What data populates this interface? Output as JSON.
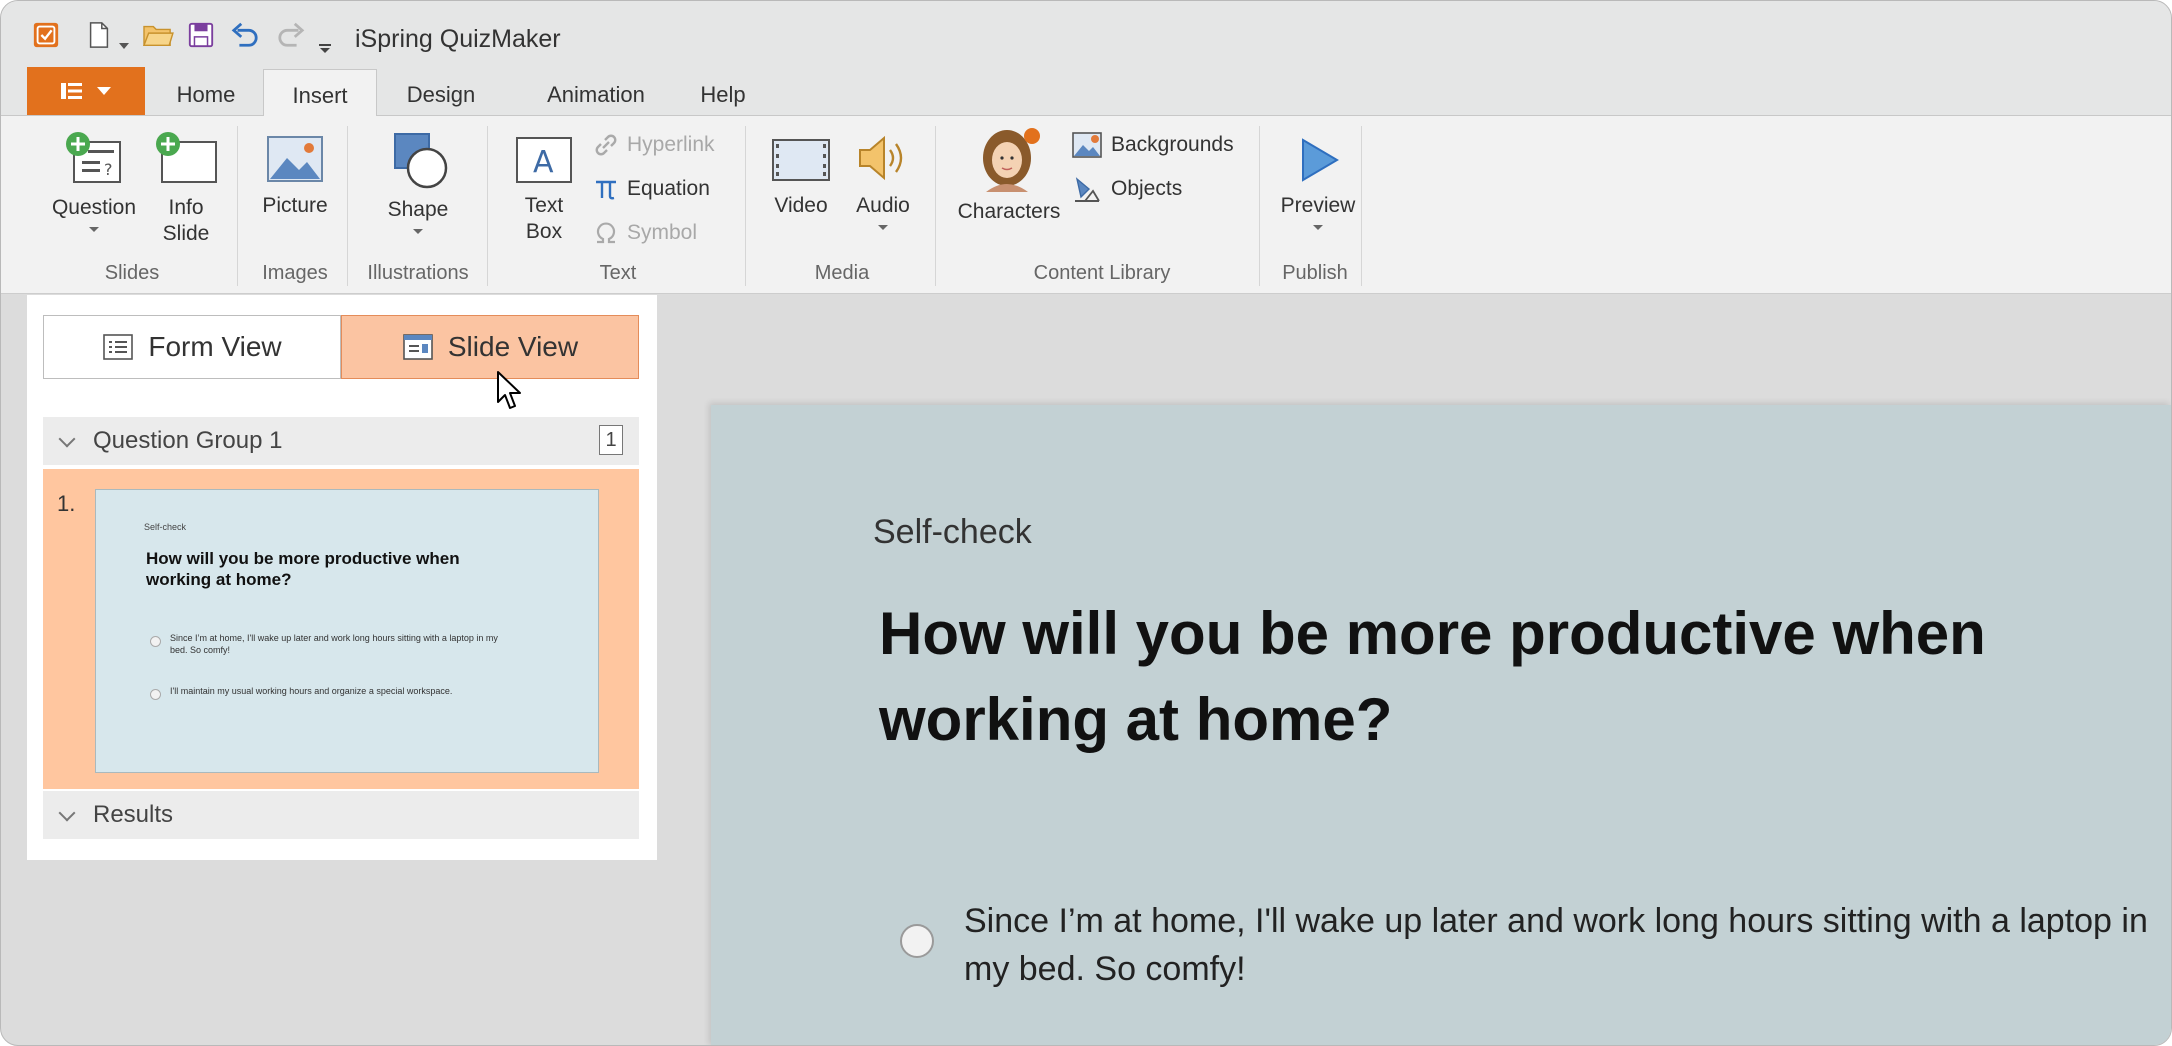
{
  "window": {
    "title": "iSpring QuizMaker"
  },
  "tabs": [
    {
      "label": "Home"
    },
    {
      "label": "Insert"
    },
    {
      "label": "Design"
    },
    {
      "label": "Animation"
    },
    {
      "label": "Help"
    }
  ],
  "active_tab": "Insert",
  "ribbon": {
    "slides": {
      "question": "Question",
      "info1": "Info",
      "info2": "Slide",
      "group": "Slides"
    },
    "images": {
      "picture": "Picture",
      "group": "Images"
    },
    "illustrations": {
      "shape": "Shape",
      "group": "Illustrations"
    },
    "text": {
      "textbox1": "Text",
      "textbox2": "Box",
      "hyperlink": "Hyperlink",
      "equation": "Equation",
      "symbol": "Symbol",
      "group": "Text"
    },
    "media": {
      "video": "Video",
      "audio": "Audio",
      "group": "Media"
    },
    "content_library": {
      "characters": "Characters",
      "backgrounds": "Backgrounds",
      "objects": "Objects",
      "group": "Content Library"
    },
    "publish": {
      "preview": "Preview",
      "group": "Publish"
    }
  },
  "left_panel": {
    "form_view": "Form View",
    "slide_view": "Slide View",
    "question_group": {
      "label": "Question Group 1",
      "count": "1"
    },
    "slide_item": {
      "number": "1.",
      "thumb_label": "Self-check",
      "thumb_question": "How will you be more productive when working at home?",
      "thumb_option1": "Since I’m at home, I'll wake up later and work long hours sitting with a laptop in my bed. So comfy!",
      "thumb_option2": "I'll maintain my usual working hours and organize a special workspace."
    },
    "results": "Results"
  },
  "slide": {
    "label": "Self-check",
    "question": "How will you be more productive when working at home?",
    "option1": "Since I’m at home, I'll wake up later and work long hours sitting with a laptop in my bed. So comfy!"
  },
  "colors": {
    "accent": "#e2711d",
    "slide_view_bg": "#fbc4a2",
    "slide_bg": "#c3d1d4",
    "thumb_bg": "#ffc69f"
  }
}
